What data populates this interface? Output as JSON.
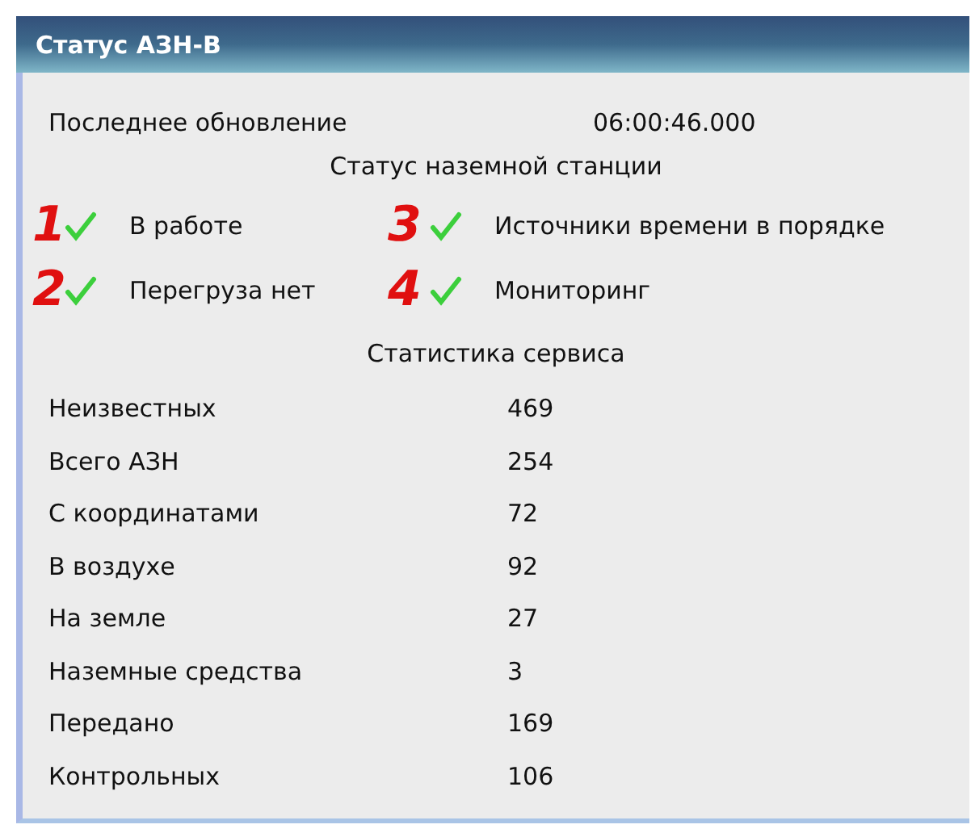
{
  "window": {
    "title": "Статус АЗН-В"
  },
  "last_update": {
    "label": "Последнее обновление",
    "value": "06:00:46.000"
  },
  "station_heading": "Статус наземной станции",
  "statuses": [
    {
      "marker": "1",
      "ok": true,
      "label": "В работе"
    },
    {
      "marker": "3",
      "ok": true,
      "label": "Источники времени в порядке"
    },
    {
      "marker": "2",
      "ok": true,
      "label": "Перегруза нет"
    },
    {
      "marker": "4",
      "ok": true,
      "label": "Мониторинг"
    }
  ],
  "stats_heading": "Статистика сервиса",
  "stats": [
    {
      "label": "Неизвестных",
      "value": "469"
    },
    {
      "label": "Всего АЗН",
      "value": "254"
    },
    {
      "label": "С координатами",
      "value": "72"
    },
    {
      "label": "В воздухе",
      "value": "92"
    },
    {
      "label": "На земле",
      "value": "27"
    },
    {
      "label": "Наземные средства",
      "value": "3"
    },
    {
      "label": "Передано",
      "value": "169"
    },
    {
      "label": "Контрольных",
      "value": "106"
    }
  ]
}
